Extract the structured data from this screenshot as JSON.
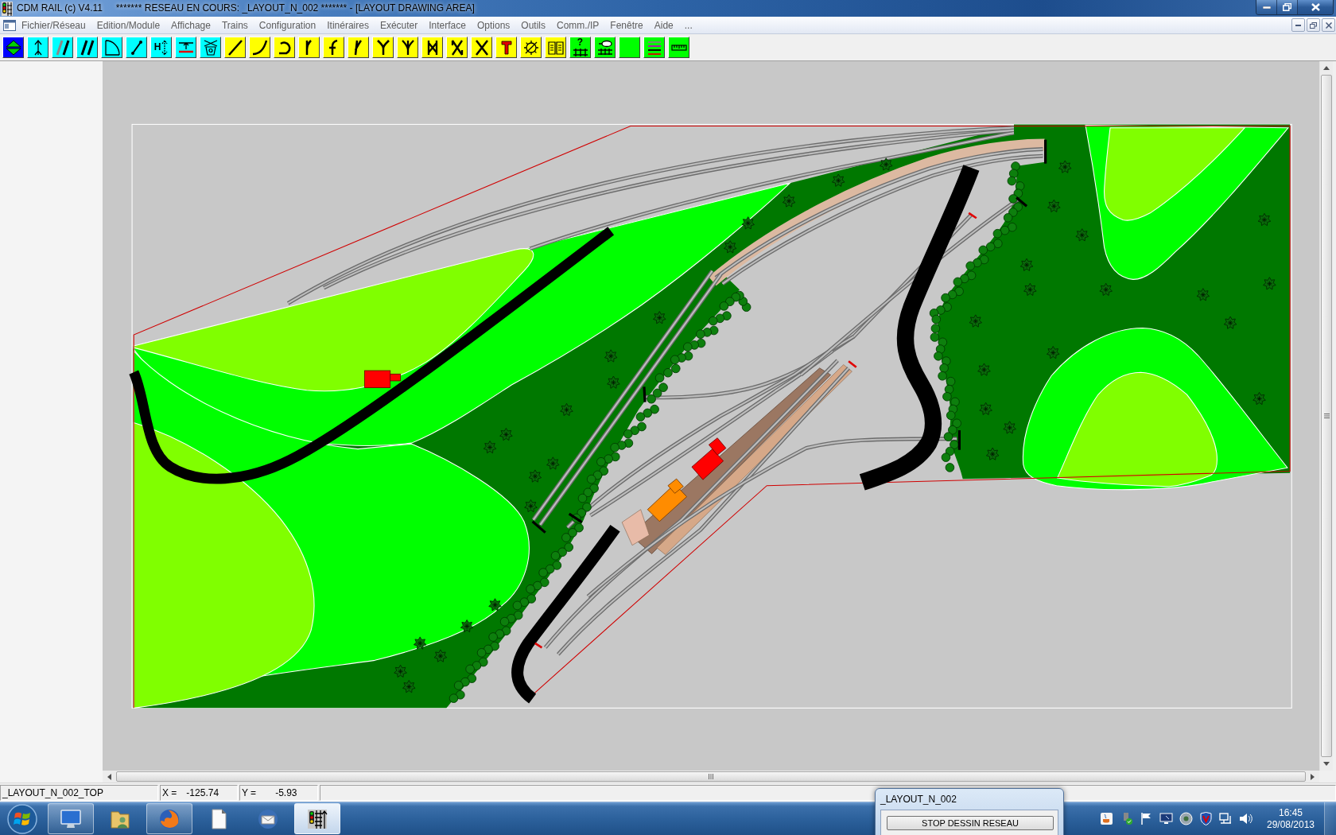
{
  "window": {
    "title": "CDM RAIL (c) V4.11     ******* RESEAU EN COURS: _LAYOUT_N_002 ******* - [LAYOUT DRAWING AREA]"
  },
  "menu": [
    {
      "label": "Fichier/Réseau"
    },
    {
      "label": "Edition/Module"
    },
    {
      "label": "Affichage"
    },
    {
      "label": "Trains"
    },
    {
      "label": "Configuration"
    },
    {
      "label": "Itinéraires"
    },
    {
      "label": "Exécuter"
    },
    {
      "label": "Interface"
    },
    {
      "label": "Options"
    },
    {
      "label": "Outils"
    },
    {
      "label": "Comm./IP"
    },
    {
      "label": "Fenêtre"
    },
    {
      "label": "Aide"
    },
    {
      "label": "..."
    }
  ],
  "toolbar": [
    {
      "color": "#0000ff"
    },
    {
      "color": "#00ffff"
    },
    {
      "color": "#00ffff"
    },
    {
      "color": "#00ffff"
    },
    {
      "color": "#00ffff"
    },
    {
      "color": "#00ffff"
    },
    {
      "color": "#00ffff",
      "label": "H"
    },
    {
      "color": "#00ffff"
    },
    {
      "color": "#00ffff"
    },
    {
      "color": "#ffff00"
    },
    {
      "color": "#ffff00"
    },
    {
      "color": "#ffff00"
    },
    {
      "color": "#ffff00"
    },
    {
      "color": "#ffff00"
    },
    {
      "color": "#ffff00"
    },
    {
      "color": "#ffff00"
    },
    {
      "color": "#ffff00"
    },
    {
      "color": "#ffff00"
    },
    {
      "color": "#ffff00"
    },
    {
      "color": "#ffff00"
    },
    {
      "color": "#ffff00"
    },
    {
      "color": "#ffff00"
    },
    {
      "color": "#ffff00"
    },
    {
      "color": "#00ff00",
      "label": "?"
    },
    {
      "color": "#00ff00"
    },
    {
      "color": "#00ff00"
    },
    {
      "color": "#00ff00"
    },
    {
      "color": "#00ff00"
    }
  ],
  "status_bar": {
    "layer": "_LAYOUT_N_002_TOP",
    "x_label": "X =",
    "x_value": "-125.74",
    "y_label": "Y =",
    "y_value": "-5.93"
  },
  "taskbar": {
    "apps": [
      {
        "running": true,
        "selected": false
      },
      {
        "running": false,
        "selected": false
      },
      {
        "running": true,
        "selected": false
      },
      {
        "running": false,
        "selected": false
      },
      {
        "running": false,
        "selected": false
      },
      {
        "running": true,
        "selected": true
      }
    ],
    "clock": {
      "time": "16:45",
      "date": "29/08/2013"
    }
  },
  "dialog": {
    "title": "_LAYOUT_N_002",
    "button": "STOP DESSIN RESEAU"
  }
}
